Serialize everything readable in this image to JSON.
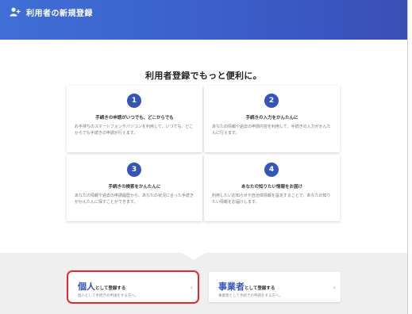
{
  "header": {
    "title": "利用者の新規登録",
    "icon": "add-user-icon"
  },
  "main": {
    "heading": "利用者登録でもっと便利に。"
  },
  "cards": [
    {
      "num": "1",
      "title": "手続きの申請がいつでも、どこからでも",
      "desc": "お手持ちのスマートフォンやパソコンを利用して、いつでも、どこからでも手続きの申請が行えます。"
    },
    {
      "num": "2",
      "title": "手続きの入力をかんたんに",
      "desc": "あなたの情報や過去の申請内容を利用して、手続きの入力がかんたんに行えます。"
    },
    {
      "num": "3",
      "title": "手続きの検索をかんたんに",
      "desc": "あなたの情報や過去の申請履歴から、あなたの状況に合った手続きがかんたんに探すことができます。"
    },
    {
      "num": "4",
      "title": "あなたの知りたい情報をお届け",
      "desc": "利用したいお知らせや自治体情報を設定することで、あなたの知りたい情報をお届けします。"
    }
  ],
  "buttons": {
    "individual": {
      "big": "個人",
      "small": "として登録する",
      "desc": "個人として手続きの申請をする方へ。",
      "chevron": "›"
    },
    "business": {
      "big": "事業者",
      "small": "として登録する",
      "desc": "事業者として手続きの申請をする方へ。",
      "chevron": "›"
    }
  },
  "colors": {
    "accent": "#3555b8",
    "header": "#3b5fc9",
    "highlight": "#e22a2a"
  }
}
